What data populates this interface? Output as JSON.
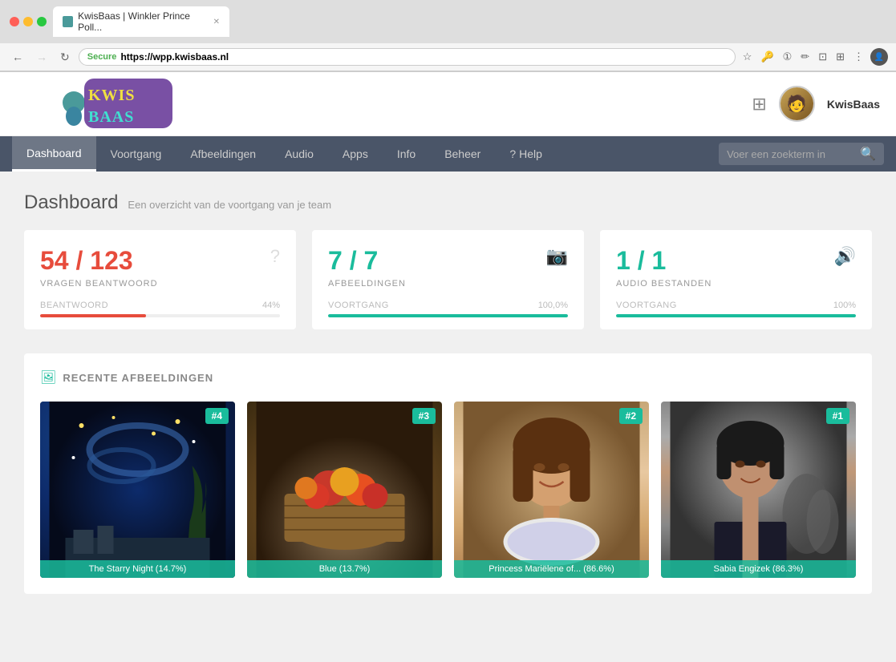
{
  "browser": {
    "tab_title": "KwisBaas | Winkler Prince Poll...",
    "url_secure": "Secure",
    "url_domain": "https://",
    "url_bold": "wpp.kwisbaas.nl"
  },
  "header": {
    "logo_alt": "KwisBaas",
    "grid_icon": "⊞",
    "username": "KwisBaas"
  },
  "nav": {
    "items": [
      {
        "label": "Dashboard",
        "active": true
      },
      {
        "label": "Voortgang",
        "active": false
      },
      {
        "label": "Afbeeldingen",
        "active": false
      },
      {
        "label": "Audio",
        "active": false
      },
      {
        "label": "Apps",
        "active": false
      },
      {
        "label": "Info",
        "active": false
      },
      {
        "label": "Beheer",
        "active": false
      }
    ],
    "help_label": "Help",
    "search_placeholder": "Voer een zoekterm in"
  },
  "page": {
    "title": "Dashboard",
    "subtitle": "Een overzicht van de voortgang van je team"
  },
  "stats": [
    {
      "number": "54 / 123",
      "label": "VRAGEN BEANTWOORD",
      "icon": "?",
      "progress_label": "BEANTWOORD",
      "progress_percent": "44%",
      "progress_value": 44,
      "color": "red"
    },
    {
      "number": "7 / 7",
      "label": "AFBEELDINGEN",
      "icon": "📷",
      "progress_label": "VOORTGANG",
      "progress_percent": "100,0%",
      "progress_value": 100,
      "color": "teal"
    },
    {
      "number": "1 / 1",
      "label": "AUDIO BESTANDEN",
      "icon": "🔊",
      "progress_label": "VOORTGANG",
      "progress_percent": "100%",
      "progress_value": 100,
      "color": "teal"
    }
  ],
  "recent_images": {
    "section_title": "RECENTE AFBEELDINGEN",
    "images": [
      {
        "badge": "#4",
        "caption": "The Starry Night (14.7%)",
        "style": "starry"
      },
      {
        "badge": "#3",
        "caption": "Blue (13.7%)",
        "style": "fruit"
      },
      {
        "badge": "#2",
        "caption": "Princess Mariëlene of... (86.6%)",
        "style": "woman1"
      },
      {
        "badge": "#1",
        "caption": "Sabia Engizek (86.3%)",
        "style": "woman2"
      }
    ]
  }
}
